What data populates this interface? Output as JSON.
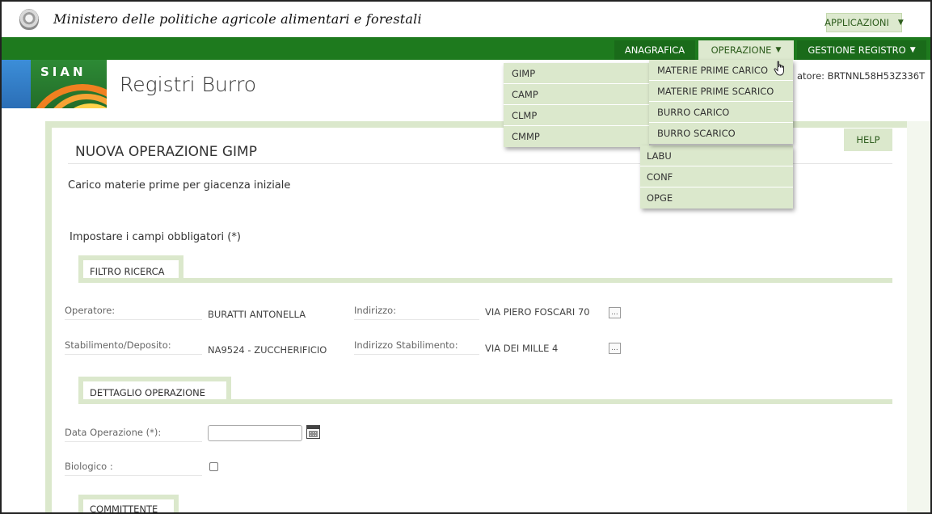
{
  "header": {
    "ministry": "Ministero delle politiche agricole alimentari e forestali",
    "applications_label": "APPLICAZIONI"
  },
  "logo": {
    "text": "SIAN"
  },
  "nav": {
    "anagrafica": "ANAGRAFICA",
    "operazione": "OPERAZIONE",
    "gestione_registro": "GESTIONE REGISTRO"
  },
  "app_title": "Registri Burro",
  "user_info": "atore: BRTNNL58H53Z336T",
  "help_label": "HELP",
  "page": {
    "title": "NUOVA OPERAZIONE GIMP",
    "subtitle": "Carico materie prime per giacenza iniziale",
    "mandatory_note": "Impostare i campi obbligatori (*)"
  },
  "filtro": {
    "tab_label": "FILTRO RICERCA",
    "operatore_label": "Operatore:",
    "operatore_value": "BURATTI ANTONELLA",
    "indirizzo_label": "Indirizzo:",
    "indirizzo_value": "VIA PIERO FOSCARI 70",
    "stabilimento_label": "Stabilimento/Deposito:",
    "stabilimento_value": "NA9524 - ZUCCHERIFICIO",
    "indirizzo_stab_label": "Indirizzo Stabilimento:",
    "indirizzo_stab_value": "VIA DEI MILLE 4",
    "lookup_button": "..."
  },
  "dettaglio": {
    "tab_label": "DETTAGLIO OPERAZIONE",
    "data_label": "Data Operazione (*):",
    "data_value": "",
    "biologico_label": "Biologico :"
  },
  "committente": {
    "tab_label": "COMMITTENTE"
  },
  "menu_operazione": {
    "column1": [
      "GIMP",
      "CAMP",
      "CLMP",
      "CMMP"
    ],
    "column2": [
      "MATERIE PRIME CARICO",
      "MATERIE PRIME SCARICO",
      "BURRO CARICO",
      "BURRO SCARICO"
    ],
    "column3": [
      "LABU",
      "CONF",
      "OPGE"
    ]
  }
}
